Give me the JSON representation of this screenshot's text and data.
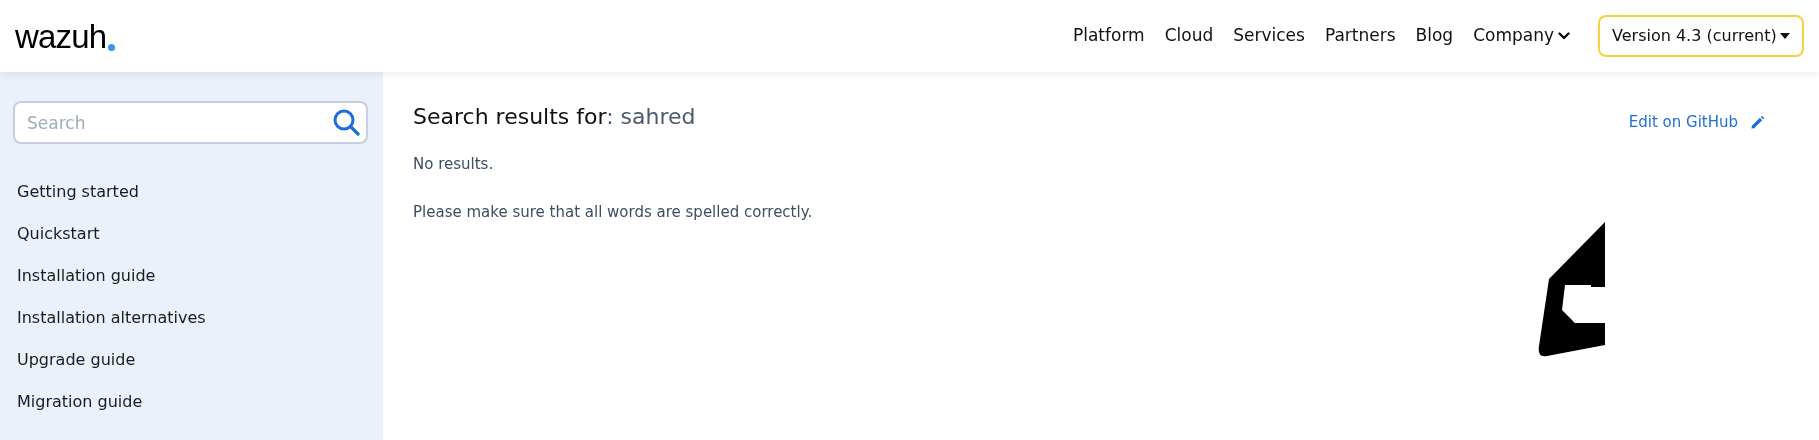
{
  "header": {
    "logo": "wazuh",
    "nav": [
      {
        "label": "Platform",
        "has_dropdown": false
      },
      {
        "label": "Cloud",
        "has_dropdown": false
      },
      {
        "label": "Services",
        "has_dropdown": false
      },
      {
        "label": "Partners",
        "has_dropdown": false
      },
      {
        "label": "Blog",
        "has_dropdown": false
      },
      {
        "label": "Company",
        "has_dropdown": true
      }
    ],
    "version_select": {
      "value": "Version 4.3 (current)"
    }
  },
  "sidebar": {
    "search": {
      "placeholder": "Search"
    },
    "items": [
      {
        "label": "Getting started"
      },
      {
        "label": "Quickstart"
      },
      {
        "label": "Installation guide"
      },
      {
        "label": "Installation alternatives"
      },
      {
        "label": "Upgrade guide"
      },
      {
        "label": "Migration guide"
      }
    ]
  },
  "main": {
    "heading": "Search results for",
    "separator": ":",
    "query": "sahred",
    "edit_link": "Edit on GitHub",
    "messages": [
      "No results.",
      "Please make sure that all words are spelled correctly."
    ]
  }
}
